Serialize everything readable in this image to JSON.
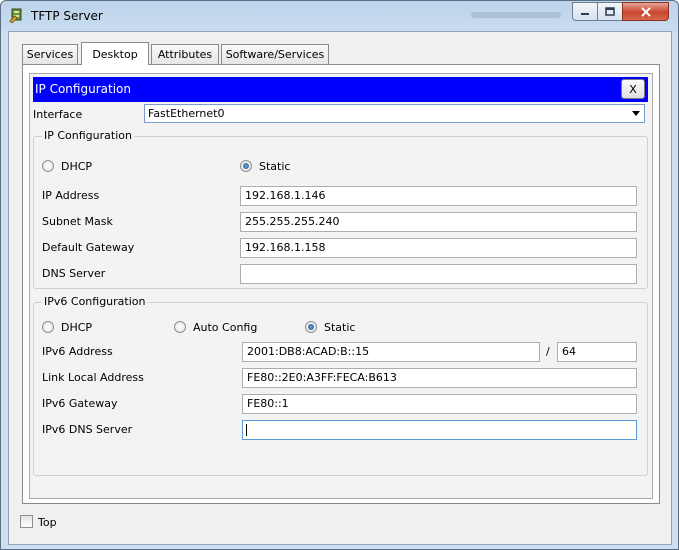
{
  "window": {
    "title": "TFTP Server"
  },
  "tabs": [
    {
      "label": "Services"
    },
    {
      "label": "Desktop"
    },
    {
      "label": "Attributes"
    },
    {
      "label": "Software/Services"
    }
  ],
  "ip_config": {
    "header": "IP Configuration",
    "close_label": "X",
    "interface_label": "Interface",
    "interface_value": "FastEthernet0",
    "ipv4": {
      "title": "IP Configuration",
      "dhcp_label": "DHCP",
      "static_label": "Static",
      "mode": "Static",
      "ip_label": "IP Address",
      "ip_value": "192.168.1.146",
      "mask_label": "Subnet Mask",
      "mask_value": "255.255.255.240",
      "gateway_label": "Default Gateway",
      "gateway_value": "192.168.1.158",
      "dns_label": "DNS Server",
      "dns_value": ""
    },
    "ipv6": {
      "title": "IPv6 Configuration",
      "dhcp_label": "DHCP",
      "auto_label": "Auto Config",
      "static_label": "Static",
      "mode": "Static",
      "addr_label": "IPv6 Address",
      "addr_value": "2001:DB8:ACAD:B::15",
      "slash": "/",
      "prefix_value": "64",
      "lla_label": "Link Local Address",
      "lla_value": "FE80::2E0:A3FF:FECA:B613",
      "gateway_label": "IPv6 Gateway",
      "gateway_value": "FE80::1",
      "dns_label": "IPv6 DNS Server",
      "dns_value": ""
    }
  },
  "footer": {
    "top_label": "Top"
  }
}
